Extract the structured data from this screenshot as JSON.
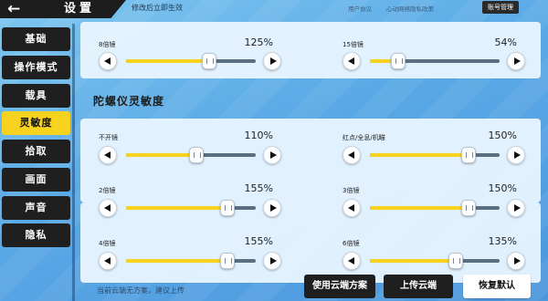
{
  "header": {
    "title": "设置",
    "hint": "修改后立即生效",
    "links": {
      "agreement": "用户协议",
      "privacy": "心动网络隐私政策"
    },
    "account_button": "账号管理"
  },
  "sidebar": {
    "items": [
      {
        "label": "基础"
      },
      {
        "label": "操作模式"
      },
      {
        "label": "载具"
      },
      {
        "label": "灵敏度",
        "active": true
      },
      {
        "label": "拾取"
      },
      {
        "label": "画面"
      },
      {
        "label": "声音"
      },
      {
        "label": "隐私"
      }
    ]
  },
  "top_settings": [
    {
      "label": "8倍镜",
      "value": "125%",
      "level": 0.64
    },
    {
      "label": "15倍镜",
      "value": "54%",
      "level": 0.22
    }
  ],
  "gyro": {
    "title": "陀螺仪灵敏度",
    "settings": [
      {
        "label": "不开镜",
        "value": "110%",
        "level": 0.54
      },
      {
        "label": "红点/全息/机瞄",
        "value": "150%",
        "level": 0.76
      },
      {
        "label": "2倍镜",
        "value": "155%",
        "level": 0.78
      },
      {
        "label": "3倍镜",
        "value": "150%",
        "level": 0.76
      },
      {
        "label": "4倍镜",
        "value": "155%",
        "level": 0.78
      },
      {
        "label": "6倍镜",
        "value": "135%",
        "level": 0.66
      }
    ]
  },
  "footer": {
    "note": "当前云端无方案，建议上传",
    "use_cloud": "使用云端方案",
    "upload_cloud": "上传云端",
    "restore_default": "恢复默认"
  },
  "colors": {
    "accent": "#f7d21f",
    "dark": "#1f1f1f",
    "track": "#5b6f82"
  }
}
